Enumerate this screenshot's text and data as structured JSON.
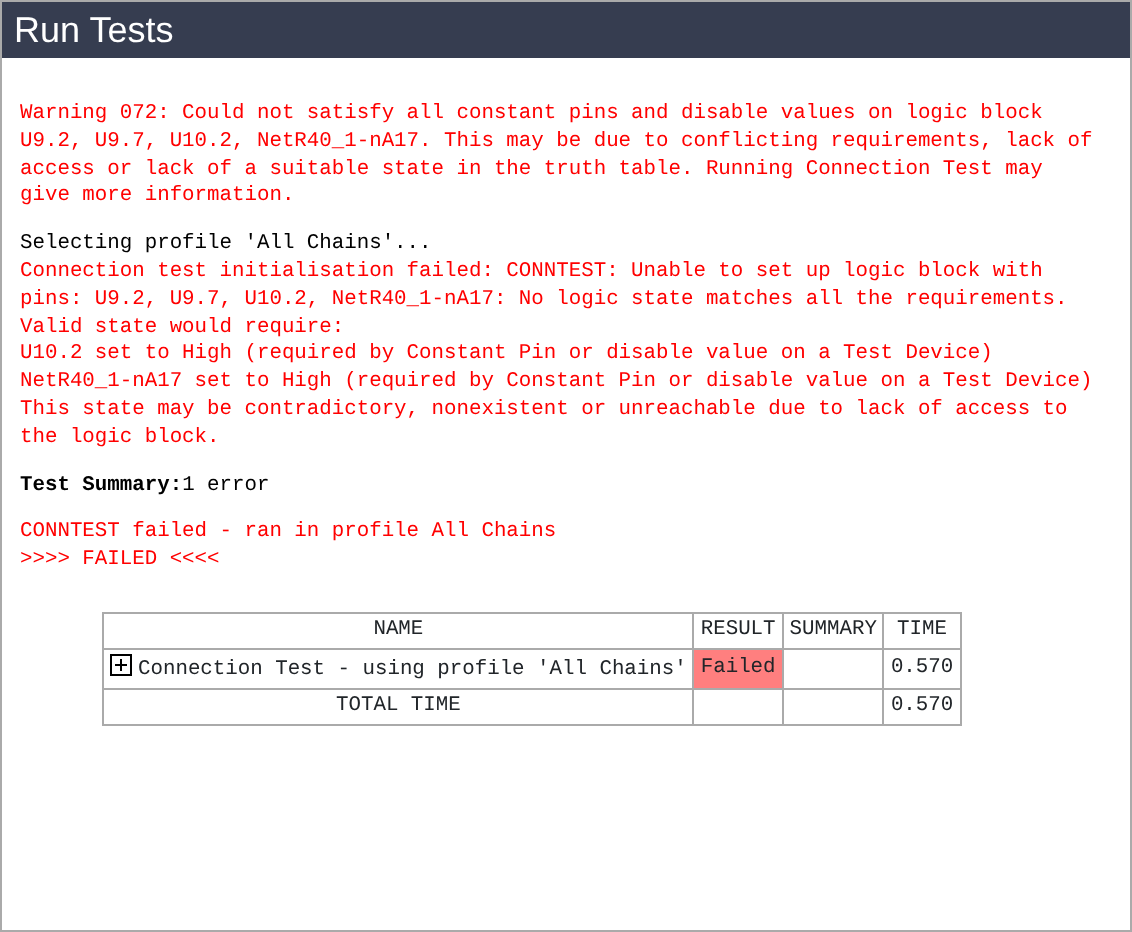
{
  "window": {
    "title": "Run Tests"
  },
  "log": [
    {
      "lines": [
        {
          "kind": "error",
          "text": "Warning 072: Could not satisfy all constant pins and disable values on logic block U9.2, U9.7, U10.2, NetR40_1-nA17. This may be due to conflicting requirements, lack of access or lack of a suitable state in the truth table. Running Connection Test may give more information."
        }
      ]
    },
    {
      "lines": [
        {
          "kind": "info",
          "text": "Selecting profile 'All Chains'..."
        },
        {
          "kind": "error",
          "text": "Connection test initialisation failed: CONNTEST: Unable to set up logic block with pins: U9.2, U9.7, U10.2, NetR40_1-nA17: No logic state matches all the requirements."
        },
        {
          "kind": "error",
          "text": "Valid state would require:"
        },
        {
          "kind": "error",
          "text": "U10.2 set to High (required by Constant Pin or disable value on a Test Device)"
        },
        {
          "kind": "error",
          "text": "NetR40_1-nA17 set to High (required by Constant Pin or disable value on a Test Device)"
        },
        {
          "kind": "error",
          "text": "This state may be contradictory, nonexistent or unreachable due to lack of access to the logic block."
        }
      ]
    },
    {
      "lines": [
        {
          "kind": "info",
          "text": "**Test Summary:**1 error"
        }
      ]
    },
    {
      "lines": [
        {
          "kind": "error",
          "text": "CONNTEST failed - ran in profile All Chains"
        },
        {
          "kind": "error",
          "text": ">>>> FAILED <<<<"
        }
      ]
    }
  ],
  "table": {
    "columns": [
      "NAME",
      "RESULT",
      "SUMMARY",
      "TIME"
    ],
    "rows": [
      {
        "expanded": false,
        "name": "Connection Test - using profile 'All Chains'",
        "result": "Failed",
        "failed": true,
        "time": "0.570"
      }
    ],
    "total": {
      "label": "TOTAL TIME",
      "time": "0.570"
    }
  }
}
